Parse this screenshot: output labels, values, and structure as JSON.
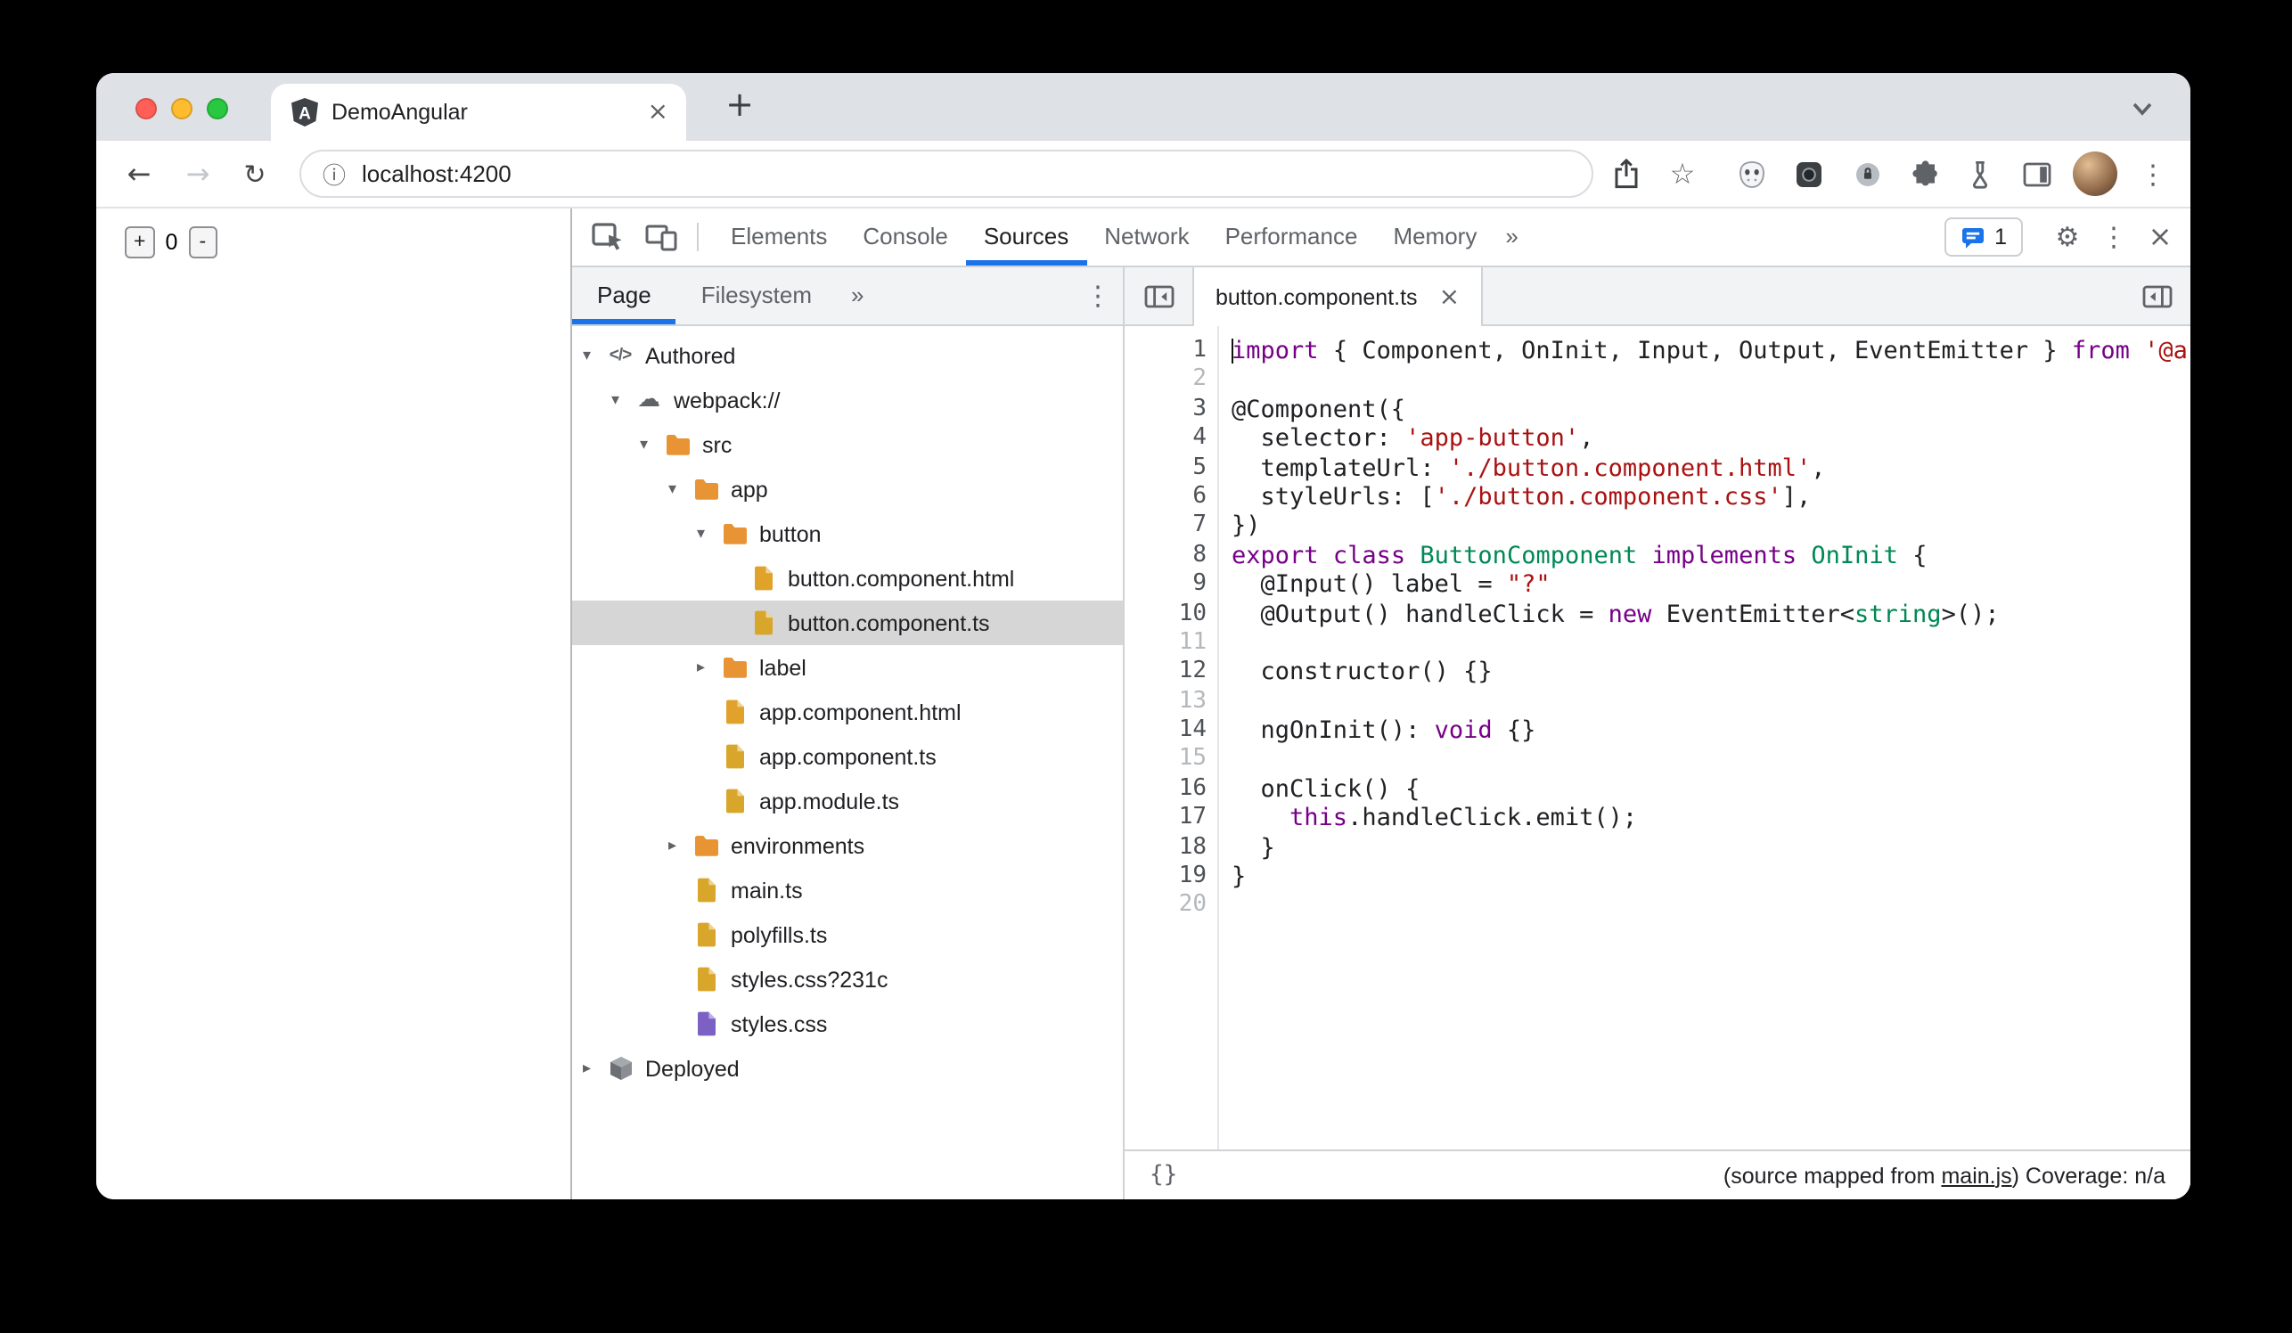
{
  "colors": {
    "accent": "#1a73e8",
    "selection": "#d6d6d6",
    "folder": "#e89435",
    "file_html": "#e0a22b",
    "file_script": "#d8a62a",
    "file_css": "#7b61c4",
    "kw": "#770088",
    "str": "#aa1111",
    "typ": "#008855",
    "tl_red": "#ff5f57",
    "tl_yellow": "#febc2e",
    "tl_green": "#28c840"
  },
  "browser": {
    "tab": {
      "title": "DemoAngular"
    },
    "new_tab_label": "+",
    "url": "localhost:4200",
    "page": {
      "increment_label": "+",
      "counter_value": "0",
      "decrement_label": "-"
    }
  },
  "devtools": {
    "toolbar": {
      "tabs": [
        "Elements",
        "Console",
        "Sources",
        "Network",
        "Performance",
        "Memory"
      ],
      "selected_tab": "Sources",
      "more_tabs_label": "»",
      "issues_count": "1"
    },
    "navigator": {
      "tabs": [
        "Page",
        "Filesystem"
      ],
      "selected_tab": "Page",
      "more_label": "»",
      "tree": [
        {
          "label": "Authored",
          "level": 0,
          "icon": "code-icon",
          "arrow": "down"
        },
        {
          "label": "webpack://",
          "level": 1,
          "icon": "cloud-icon",
          "arrow": "down"
        },
        {
          "label": "src",
          "level": 2,
          "icon": "folder-icon",
          "arrow": "down"
        },
        {
          "label": "app",
          "level": 3,
          "icon": "folder-icon",
          "arrow": "down"
        },
        {
          "label": "button",
          "level": 4,
          "icon": "folder-icon",
          "arrow": "down"
        },
        {
          "label": "button.component.html",
          "level": 5,
          "icon": "file-icon",
          "color": "html"
        },
        {
          "label": "button.component.ts",
          "level": 5,
          "icon": "file-icon",
          "color": "script",
          "selected": true
        },
        {
          "label": "label",
          "level": 4,
          "icon": "folder-icon",
          "arrow": "right"
        },
        {
          "label": "app.component.html",
          "level": 4,
          "icon": "file-icon",
          "color": "html"
        },
        {
          "label": "app.component.ts",
          "level": 4,
          "icon": "file-icon",
          "color": "script"
        },
        {
          "label": "app.module.ts",
          "level": 4,
          "icon": "file-icon",
          "color": "script"
        },
        {
          "label": "environments",
          "level": 3,
          "icon": "folder-icon",
          "arrow": "right"
        },
        {
          "label": "main.ts",
          "level": 3,
          "icon": "file-icon",
          "color": "script"
        },
        {
          "label": "polyfills.ts",
          "level": 3,
          "icon": "file-icon",
          "color": "script"
        },
        {
          "label": "styles.css?231c",
          "level": 3,
          "icon": "file-icon",
          "color": "script"
        },
        {
          "label": "styles.css",
          "level": 3,
          "icon": "file-icon",
          "color": "css"
        },
        {
          "label": "Deployed",
          "level": 0,
          "icon": "package-icon",
          "arrow": "right"
        }
      ]
    },
    "editor": {
      "tab_title": "button.component.ts",
      "status": {
        "pretty_print_label": "{}",
        "source_map_text_prefix": "(source mapped from ",
        "source_map_link": "main.js",
        "source_map_text_suffix": ") Coverage: n/a"
      },
      "code_lines": [
        {
          "n": 1,
          "tokens": [
            [
              "k",
              "import"
            ],
            [
              "d",
              " { Component, OnInit, Input, Output, EventEmitter } "
            ],
            [
              "k",
              "from"
            ],
            [
              "d",
              " "
            ],
            [
              "s",
              "'@a"
            ]
          ]
        },
        {
          "n": 2,
          "tokens": []
        },
        {
          "n": 3,
          "tokens": [
            [
              "d",
              "@Component({"
            ]
          ]
        },
        {
          "n": 4,
          "tokens": [
            [
              "d",
              "  selector: "
            ],
            [
              "s",
              "'app-button'"
            ],
            [
              "d",
              ","
            ]
          ]
        },
        {
          "n": 5,
          "tokens": [
            [
              "d",
              "  templateUrl: "
            ],
            [
              "s",
              "'./button.component.html'"
            ],
            [
              "d",
              ","
            ]
          ]
        },
        {
          "n": 6,
          "tokens": [
            [
              "d",
              "  styleUrls: ["
            ],
            [
              "s",
              "'./button.component.css'"
            ],
            [
              "d",
              "],"
            ]
          ]
        },
        {
          "n": 7,
          "tokens": [
            [
              "d",
              "})"
            ]
          ]
        },
        {
          "n": 8,
          "tokens": [
            [
              "k",
              "export"
            ],
            [
              "d",
              " "
            ],
            [
              "k",
              "class"
            ],
            [
              "d",
              " "
            ],
            [
              "t",
              "ButtonComponent"
            ],
            [
              "d",
              " "
            ],
            [
              "k",
              "implements"
            ],
            [
              "d",
              " "
            ],
            [
              "t",
              "OnInit"
            ],
            [
              "d",
              " {"
            ]
          ]
        },
        {
          "n": 9,
          "tokens": [
            [
              "d",
              "  @Input() label = "
            ],
            [
              "s",
              "\"?\""
            ]
          ]
        },
        {
          "n": 10,
          "tokens": [
            [
              "d",
              "  @Output() handleClick = "
            ],
            [
              "k",
              "new"
            ],
            [
              "d",
              " EventEmitter<"
            ],
            [
              "t",
              "string"
            ],
            [
              "d",
              ">();"
            ]
          ]
        },
        {
          "n": 11,
          "tokens": []
        },
        {
          "n": 12,
          "tokens": [
            [
              "d",
              "  constructor() {}"
            ]
          ]
        },
        {
          "n": 13,
          "tokens": []
        },
        {
          "n": 14,
          "tokens": [
            [
              "d",
              "  ngOnInit(): "
            ],
            [
              "k",
              "void"
            ],
            [
              "d",
              " {}"
            ]
          ]
        },
        {
          "n": 15,
          "tokens": []
        },
        {
          "n": 16,
          "tokens": [
            [
              "d",
              "  onClick() {"
            ]
          ]
        },
        {
          "n": 17,
          "tokens": [
            [
              "d",
              "    "
            ],
            [
              "k",
              "this"
            ],
            [
              "d",
              ".handleClick.emit();"
            ]
          ]
        },
        {
          "n": 18,
          "tokens": [
            [
              "d",
              "  }"
            ]
          ]
        },
        {
          "n": 19,
          "tokens": [
            [
              "d",
              "}"
            ]
          ]
        },
        {
          "n": 20,
          "tokens": []
        }
      ]
    }
  }
}
